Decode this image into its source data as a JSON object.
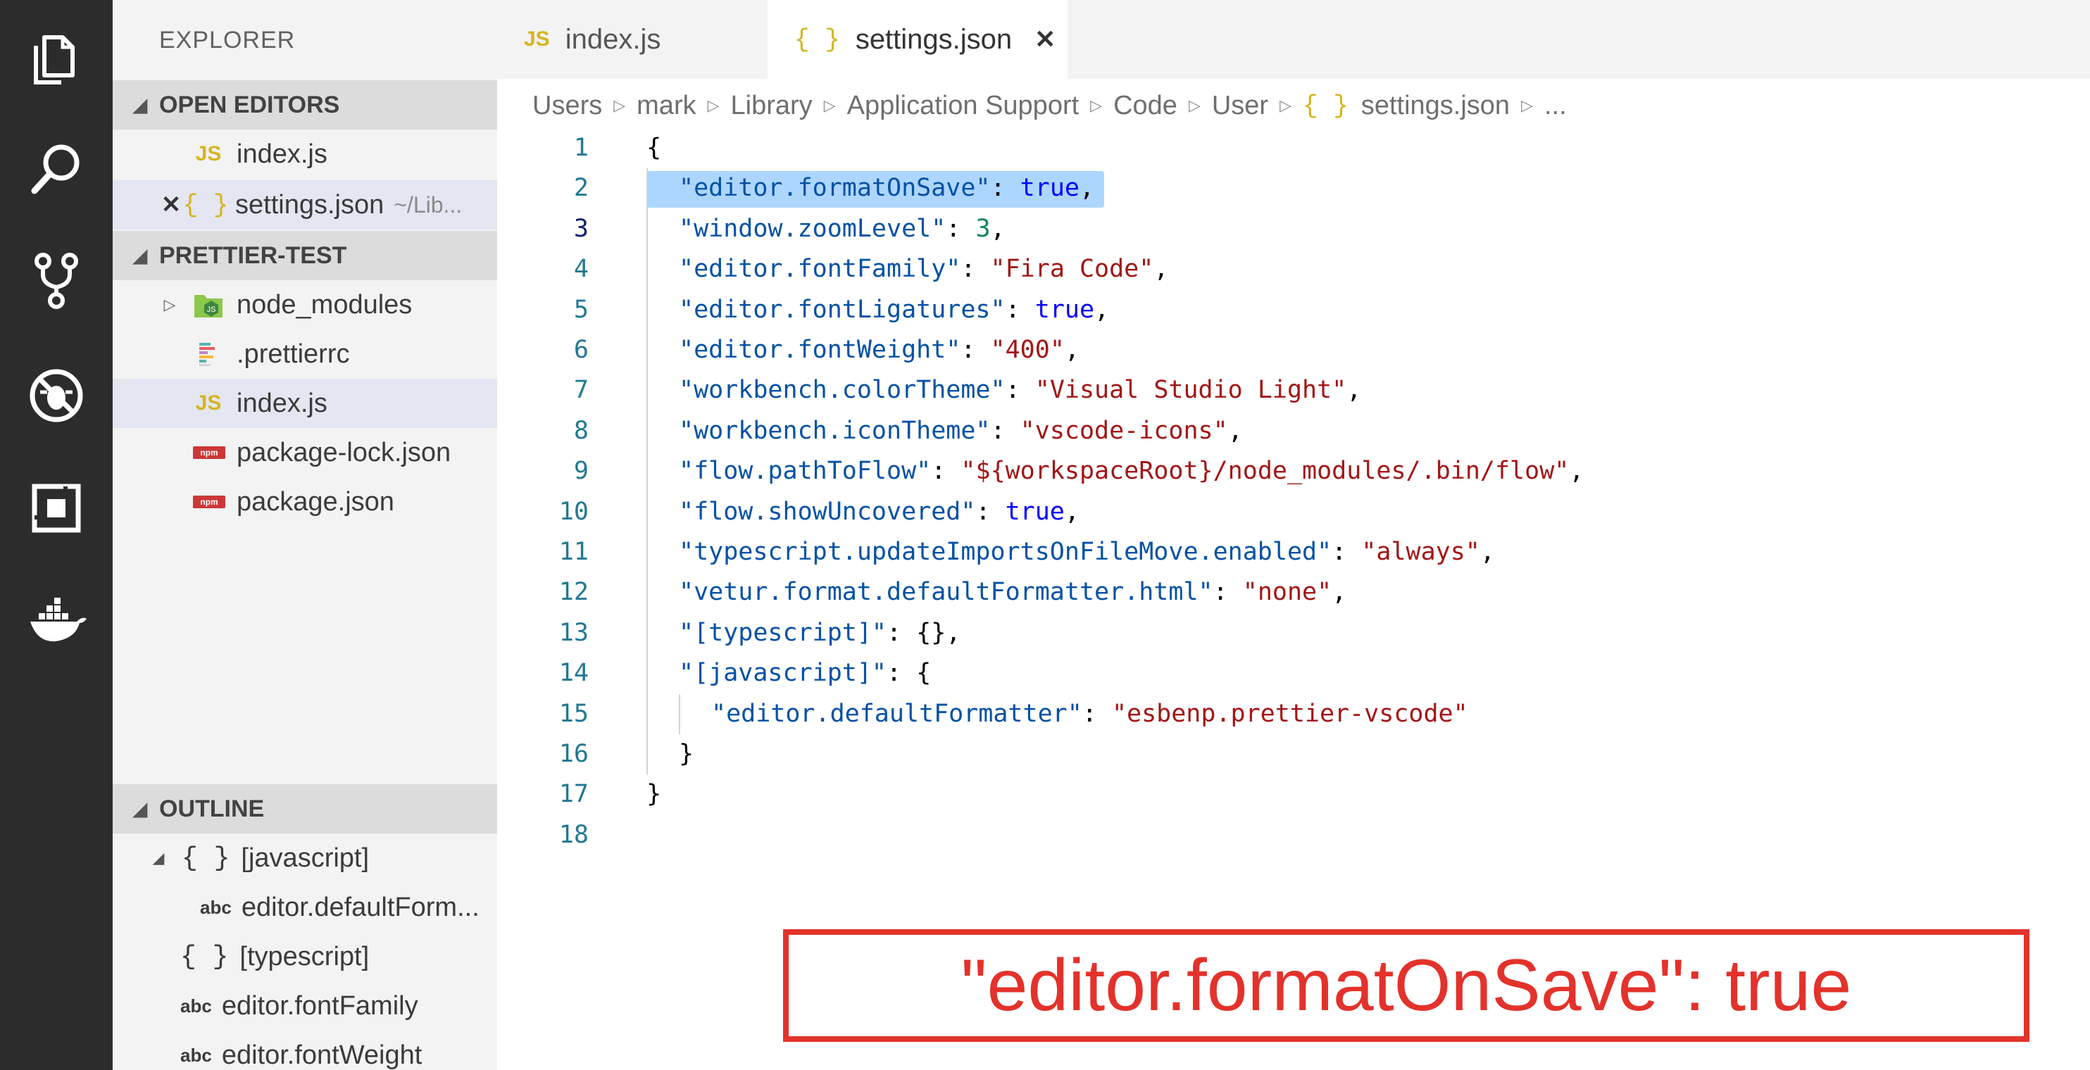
{
  "activity_bar": {
    "icons": [
      "files-icon",
      "search-icon",
      "source-control-icon",
      "debug-icon",
      "extensions-icon",
      "docker-icon"
    ]
  },
  "sidebar": {
    "title": "EXPLORER",
    "open_editors": {
      "header": "OPEN EDITORS",
      "items": [
        {
          "icon": "JS",
          "name": "index.js"
        },
        {
          "close": "✕",
          "icon": "{ }",
          "name": "settings.json",
          "path": "~/Lib..."
        }
      ]
    },
    "project": {
      "header": "PRETTIER-TEST",
      "items": [
        {
          "name": "node_modules"
        },
        {
          "name": ".prettierrc"
        },
        {
          "icon": "JS",
          "name": "index.js"
        },
        {
          "icon": "npm",
          "name": "package-lock.json"
        },
        {
          "icon": "npm",
          "name": "package.json"
        }
      ]
    },
    "outline": {
      "header": "OUTLINE",
      "items": [
        {
          "icon": "{ }",
          "name": "[javascript]"
        },
        {
          "icon": "abc",
          "name": "editor.defaultForm..."
        },
        {
          "icon": "{ }",
          "name": "[typescript]"
        },
        {
          "icon": "abc",
          "name": "editor.fontFamily"
        },
        {
          "icon": "abc",
          "name": "editor.fontWeight"
        }
      ]
    }
  },
  "tabs": [
    {
      "icon": "JS",
      "label": "index.js"
    },
    {
      "icon": "{ }",
      "label": "settings.json",
      "close": "✕"
    }
  ],
  "breadcrumb": {
    "items": [
      "Users",
      "mark",
      "Library",
      "Application Support",
      "Code",
      "User"
    ],
    "file_icon": "{ }",
    "file": "settings.json",
    "ellipsis": "..."
  },
  "editor": {
    "line_numbers": [
      "1",
      "2",
      "3",
      "4",
      "5",
      "6",
      "7",
      "8",
      "9",
      "10",
      "11",
      "12",
      "13",
      "14",
      "15",
      "16",
      "17",
      "18"
    ],
    "lines": [
      {
        "p": "{"
      },
      {
        "k": "\"editor.formatOnSave\"",
        "v": "true",
        "vt": "b",
        "end": ","
      },
      {
        "k": "\"window.zoomLevel\"",
        "v": "3",
        "vt": "n",
        "end": ","
      },
      {
        "k": "\"editor.fontFamily\"",
        "v": "\"Fira Code\"",
        "vt": "s",
        "end": ","
      },
      {
        "k": "\"editor.fontLigatures\"",
        "v": "true",
        "vt": "b",
        "end": ","
      },
      {
        "k": "\"editor.fontWeight\"",
        "v": "\"400\"",
        "vt": "s",
        "end": ","
      },
      {
        "k": "\"workbench.colorTheme\"",
        "v": "\"Visual Studio Light\"",
        "vt": "s",
        "end": ","
      },
      {
        "k": "\"workbench.iconTheme\"",
        "v": "\"vscode-icons\"",
        "vt": "s",
        "end": ","
      },
      {
        "k": "\"flow.pathToFlow\"",
        "v": "\"${workspaceRoot}/node_modules/.bin/flow\"",
        "vt": "s",
        "end": ","
      },
      {
        "k": "\"flow.showUncovered\"",
        "v": "true",
        "vt": "b",
        "end": ","
      },
      {
        "k": "\"typescript.updateImportsOnFileMove.enabled\"",
        "v": "\"always\"",
        "vt": "s",
        "end": ","
      },
      {
        "k": "\"vetur.format.defaultFormatter.html\"",
        "v": "\"none\"",
        "vt": "s",
        "end": ","
      },
      {
        "k": "\"[typescript]\"",
        "v": "{}",
        "vt": "p",
        "end": ","
      },
      {
        "k": "\"[javascript]\"",
        "v": "{",
        "vt": "p",
        "end": ""
      },
      {
        "k": "\"editor.defaultFormatter\"",
        "v": "\"esbenp.prettier-vscode\"",
        "vt": "s",
        "end": "",
        "indent": 2
      },
      {
        "p": "}",
        "indent": 1
      },
      {
        "p": "}"
      },
      {
        "p": ""
      }
    ]
  },
  "callout": {
    "text": "\"editor.formatOnSave\": true"
  },
  "colors": {
    "accent_red": "#e3322b",
    "selection": "#add6ff",
    "activity_bar": "#2c2c2c"
  }
}
